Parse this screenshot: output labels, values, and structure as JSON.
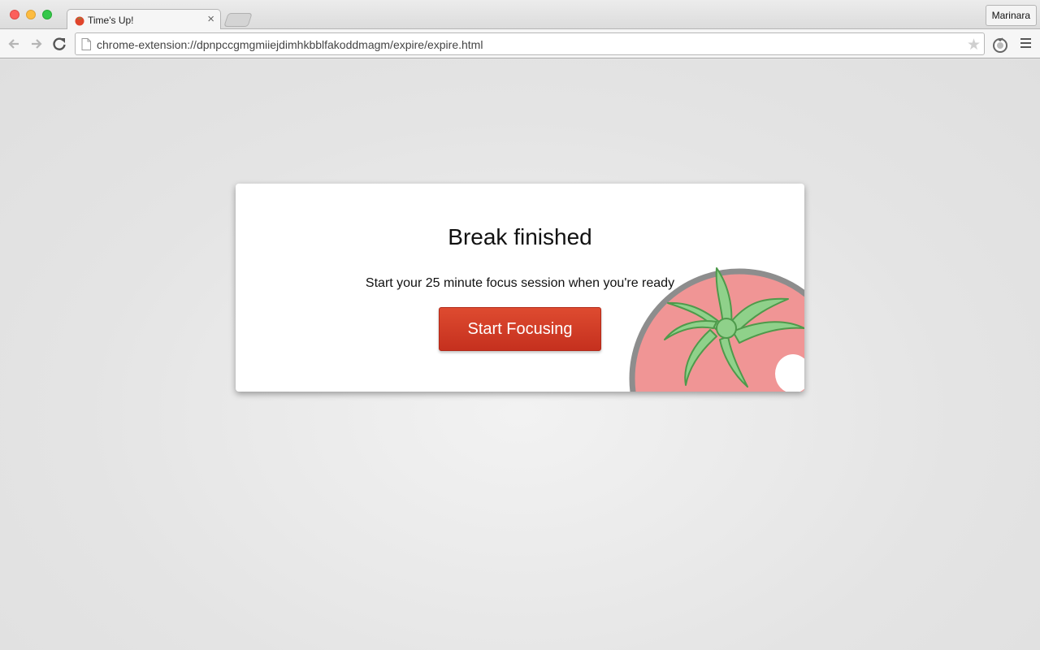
{
  "browser": {
    "tab": {
      "title": "Time's Up!",
      "close_glyph": "×"
    },
    "profile_label": "Marinara",
    "address": "chrome-extension://dpnpccgmgmiiejdimhkbblfakoddmagm/expire/expire.html"
  },
  "page": {
    "title": "Break finished",
    "subtitle": "Start your 25 minute focus session when you're ready",
    "button_label": "Start Focusing"
  },
  "colors": {
    "accent": "#d23f27",
    "tomato": "#f09595",
    "leaf": "#7ec97a"
  }
}
